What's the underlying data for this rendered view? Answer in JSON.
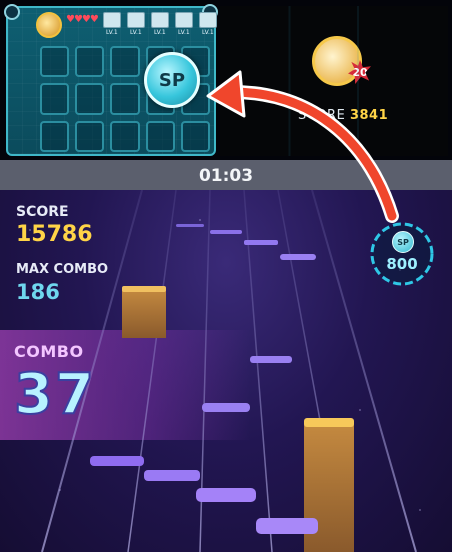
{
  "top_preview": {
    "level_slots": [
      "LV.1",
      "LV.1",
      "LV.1",
      "LV.1",
      "LV.1"
    ],
    "sp_bubble_label": "SP",
    "peer": {
      "badge": "20",
      "score_label": "SCORE",
      "score_value": "3841"
    }
  },
  "timer": "01:03",
  "hud": {
    "score_label": "SCORE",
    "score_value": "15786",
    "max_combo_label": "MAX COMBO",
    "max_combo_value": "186",
    "combo_label": "COMBO",
    "combo_value": "37"
  },
  "sp_gauge": {
    "label": "SP",
    "value": "800"
  },
  "colors": {
    "gold": "#ffd447",
    "cyan": "#6fd7ee",
    "arrow": "#f0462c",
    "note": "#8f6cf0",
    "hold": "#b07a3a"
  },
  "icons": [
    "heart-icon",
    "character-avatar-icon",
    "sp-orb-icon",
    "level-item-icon"
  ]
}
